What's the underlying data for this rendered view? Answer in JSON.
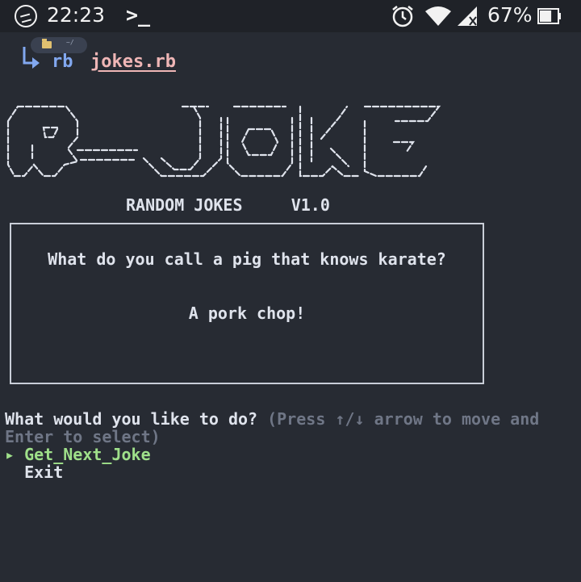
{
  "status_bar": {
    "time": "22:23",
    "terminal_glyph": ">_",
    "battery_percent": "67%",
    "icons": [
      "app-icon",
      "terminal-icon",
      "alarm-icon",
      "wifi-icon",
      "signal-icon",
      "battery-icon"
    ],
    "battery_level": 0.67
  },
  "prompt": {
    "command": "rb",
    "file": "jokes.rb",
    "folder_chip_text": "~/"
  },
  "app": {
    "title": "RANDOM JOKES     V1.0"
  },
  "joke": {
    "question": "What do you call a pig that knows karate?",
    "answer": "A pork chop!"
  },
  "menu": {
    "question": "What would you like to do?",
    "hint": "(Press ↑/↓ arrow to move and Enter to select)",
    "pointer": "▸",
    "options": [
      "Get_Next_Joke",
      "Exit"
    ],
    "selected_index": 0
  },
  "colors": {
    "background": "#272b33",
    "status_bar": "#1f2228",
    "selected_option": "#9fe08a",
    "hint_text": "#6f7686",
    "command": "#82a8f0",
    "file": "#efb6b6"
  }
}
